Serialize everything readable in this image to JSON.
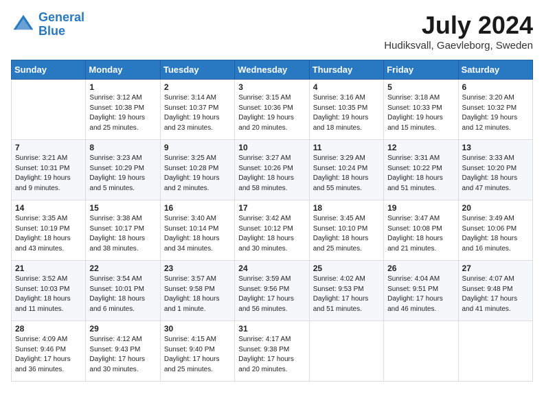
{
  "header": {
    "logo_line1": "General",
    "logo_line2": "Blue",
    "month": "July 2024",
    "location": "Hudiksvall, Gaevleborg, Sweden"
  },
  "weekdays": [
    "Sunday",
    "Monday",
    "Tuesday",
    "Wednesday",
    "Thursday",
    "Friday",
    "Saturday"
  ],
  "weeks": [
    [
      {
        "day": "",
        "info": ""
      },
      {
        "day": "1",
        "info": "Sunrise: 3:12 AM\nSunset: 10:38 PM\nDaylight: 19 hours\nand 25 minutes."
      },
      {
        "day": "2",
        "info": "Sunrise: 3:14 AM\nSunset: 10:37 PM\nDaylight: 19 hours\nand 23 minutes."
      },
      {
        "day": "3",
        "info": "Sunrise: 3:15 AM\nSunset: 10:36 PM\nDaylight: 19 hours\nand 20 minutes."
      },
      {
        "day": "4",
        "info": "Sunrise: 3:16 AM\nSunset: 10:35 PM\nDaylight: 19 hours\nand 18 minutes."
      },
      {
        "day": "5",
        "info": "Sunrise: 3:18 AM\nSunset: 10:33 PM\nDaylight: 19 hours\nand 15 minutes."
      },
      {
        "day": "6",
        "info": "Sunrise: 3:20 AM\nSunset: 10:32 PM\nDaylight: 19 hours\nand 12 minutes."
      }
    ],
    [
      {
        "day": "7",
        "info": "Sunrise: 3:21 AM\nSunset: 10:31 PM\nDaylight: 19 hours\nand 9 minutes."
      },
      {
        "day": "8",
        "info": "Sunrise: 3:23 AM\nSunset: 10:29 PM\nDaylight: 19 hours\nand 5 minutes."
      },
      {
        "day": "9",
        "info": "Sunrise: 3:25 AM\nSunset: 10:28 PM\nDaylight: 19 hours\nand 2 minutes."
      },
      {
        "day": "10",
        "info": "Sunrise: 3:27 AM\nSunset: 10:26 PM\nDaylight: 18 hours\nand 58 minutes."
      },
      {
        "day": "11",
        "info": "Sunrise: 3:29 AM\nSunset: 10:24 PM\nDaylight: 18 hours\nand 55 minutes."
      },
      {
        "day": "12",
        "info": "Sunrise: 3:31 AM\nSunset: 10:22 PM\nDaylight: 18 hours\nand 51 minutes."
      },
      {
        "day": "13",
        "info": "Sunrise: 3:33 AM\nSunset: 10:20 PM\nDaylight: 18 hours\nand 47 minutes."
      }
    ],
    [
      {
        "day": "14",
        "info": "Sunrise: 3:35 AM\nSunset: 10:19 PM\nDaylight: 18 hours\nand 43 minutes."
      },
      {
        "day": "15",
        "info": "Sunrise: 3:38 AM\nSunset: 10:17 PM\nDaylight: 18 hours\nand 38 minutes."
      },
      {
        "day": "16",
        "info": "Sunrise: 3:40 AM\nSunset: 10:14 PM\nDaylight: 18 hours\nand 34 minutes."
      },
      {
        "day": "17",
        "info": "Sunrise: 3:42 AM\nSunset: 10:12 PM\nDaylight: 18 hours\nand 30 minutes."
      },
      {
        "day": "18",
        "info": "Sunrise: 3:45 AM\nSunset: 10:10 PM\nDaylight: 18 hours\nand 25 minutes."
      },
      {
        "day": "19",
        "info": "Sunrise: 3:47 AM\nSunset: 10:08 PM\nDaylight: 18 hours\nand 21 minutes."
      },
      {
        "day": "20",
        "info": "Sunrise: 3:49 AM\nSunset: 10:06 PM\nDaylight: 18 hours\nand 16 minutes."
      }
    ],
    [
      {
        "day": "21",
        "info": "Sunrise: 3:52 AM\nSunset: 10:03 PM\nDaylight: 18 hours\nand 11 minutes."
      },
      {
        "day": "22",
        "info": "Sunrise: 3:54 AM\nSunset: 10:01 PM\nDaylight: 18 hours\nand 6 minutes."
      },
      {
        "day": "23",
        "info": "Sunrise: 3:57 AM\nSunset: 9:58 PM\nDaylight: 18 hours\nand 1 minute."
      },
      {
        "day": "24",
        "info": "Sunrise: 3:59 AM\nSunset: 9:56 PM\nDaylight: 17 hours\nand 56 minutes."
      },
      {
        "day": "25",
        "info": "Sunrise: 4:02 AM\nSunset: 9:53 PM\nDaylight: 17 hours\nand 51 minutes."
      },
      {
        "day": "26",
        "info": "Sunrise: 4:04 AM\nSunset: 9:51 PM\nDaylight: 17 hours\nand 46 minutes."
      },
      {
        "day": "27",
        "info": "Sunrise: 4:07 AM\nSunset: 9:48 PM\nDaylight: 17 hours\nand 41 minutes."
      }
    ],
    [
      {
        "day": "28",
        "info": "Sunrise: 4:09 AM\nSunset: 9:46 PM\nDaylight: 17 hours\nand 36 minutes."
      },
      {
        "day": "29",
        "info": "Sunrise: 4:12 AM\nSunset: 9:43 PM\nDaylight: 17 hours\nand 30 minutes."
      },
      {
        "day": "30",
        "info": "Sunrise: 4:15 AM\nSunset: 9:40 PM\nDaylight: 17 hours\nand 25 minutes."
      },
      {
        "day": "31",
        "info": "Sunrise: 4:17 AM\nSunset: 9:38 PM\nDaylight: 17 hours\nand 20 minutes."
      },
      {
        "day": "",
        "info": ""
      },
      {
        "day": "",
        "info": ""
      },
      {
        "day": "",
        "info": ""
      }
    ]
  ]
}
